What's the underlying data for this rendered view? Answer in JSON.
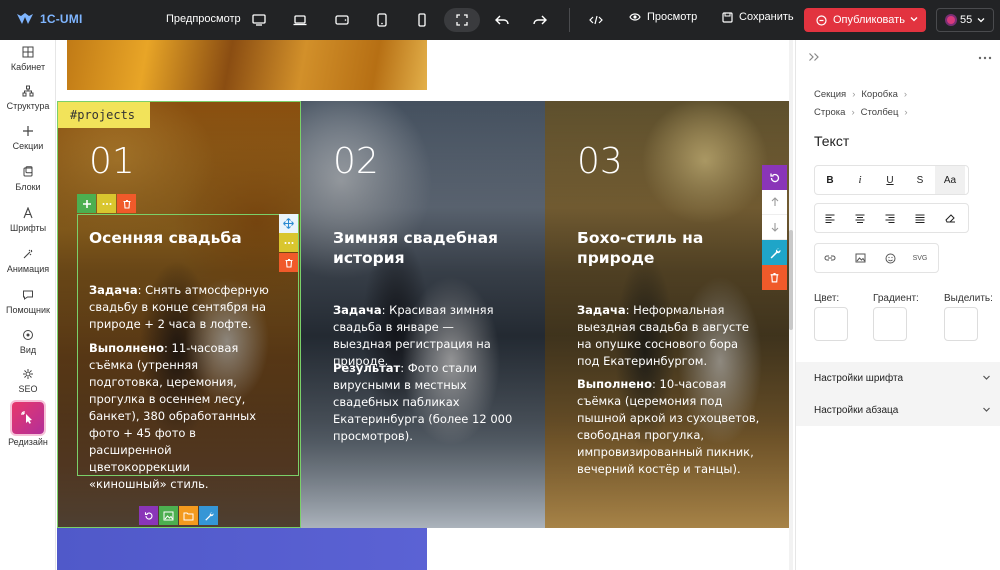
{
  "topbar": {
    "logo_text": "1C-UMI",
    "preview_label": "Предпросмотр",
    "view_label": "Просмотр",
    "save_label": "Сохранить",
    "publish_label": "Опубликовать",
    "credits_count": "55",
    "device_icons": [
      "desktop-icon",
      "laptop-icon",
      "tablet-landscape-icon",
      "tablet-icon",
      "phone-icon"
    ],
    "accent_color": "#e2333f"
  },
  "sidebar": {
    "items": [
      {
        "label": "Кабинет",
        "icon": "grid-icon"
      },
      {
        "label": "Структура",
        "icon": "structure-icon"
      },
      {
        "label": "Секции",
        "icon": "plus-icon"
      },
      {
        "label": "Блоки",
        "icon": "blocks-icon"
      },
      {
        "label": "Шрифты",
        "icon": "font-icon"
      },
      {
        "label": "Анимация",
        "icon": "animation-icon"
      },
      {
        "label": "Помощник",
        "icon": "chat-icon"
      },
      {
        "label": "Вид",
        "icon": "eye-icon"
      },
      {
        "label": "SEO",
        "icon": "seo-icon"
      },
      {
        "label": "Редизайн",
        "icon": "redesign-icon"
      }
    ]
  },
  "canvas": {
    "section_tag": "#projects",
    "panels": [
      {
        "number": "01",
        "title": "Осенняя свадьба",
        "p1_label": "Задача",
        "p1_text": ": Снять атмосферную свадьбу в конце сентября на природе + 2 часа в лофте.",
        "p2_label": "Выполнено",
        "p2_text": ": 11-часовая съёмка (утренняя подготовка, церемония, прогулка в осеннем лесу, банкет), 380 обработанных фото + 45 фото в расширенной цветокоррекции «киношный» стиль."
      },
      {
        "number": "02",
        "title": "Зимняя свадебная история",
        "p1_label": "Задача",
        "p1_text": ": Красивая зимняя свадьба в январе — выездная регистрация на природе.",
        "p2_label": "Результат",
        "p2_text": ": Фото стали вирусными в местных свадебных пабликах Екатеринбурга (более 12 000 просмотров)."
      },
      {
        "number": "03",
        "title": "Бохо-стиль на природе",
        "p1_label": "Задача",
        "p1_text": ": Неформальная выездная свадьба в августе на опушке соснового бора под Екатеринбургом.",
        "p2_label": "Выполнено",
        "p2_text": ": 10-часовая съёмка (церемония под пышной аркой из сухоцветов, свободная прогулка, импровизированный пикник, вечерний костёр и танцы)."
      }
    ]
  },
  "rpanel": {
    "breadcrumb_row1": [
      "Секция",
      "Коробка"
    ],
    "breadcrumb_row2": [
      "Строка",
      "Столбец"
    ],
    "title": "Текст",
    "format_buttons": [
      "B",
      "i",
      "U",
      "S",
      "Aa"
    ],
    "insert_svg_label": "SVG",
    "color_label": "Цвет:",
    "gradient_label": "Градиент:",
    "highlight_label": "Выделить:",
    "font_settings_label": "Настройки шрифта",
    "paragraph_settings_label": "Настройки абзаца"
  }
}
